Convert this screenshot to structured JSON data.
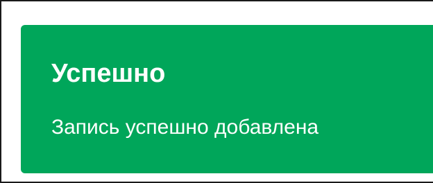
{
  "alert": {
    "title": "Успешно",
    "message": "Запись успешно добавлена",
    "type": "success",
    "color": "#00a65a",
    "text_color": "#ffffff"
  }
}
